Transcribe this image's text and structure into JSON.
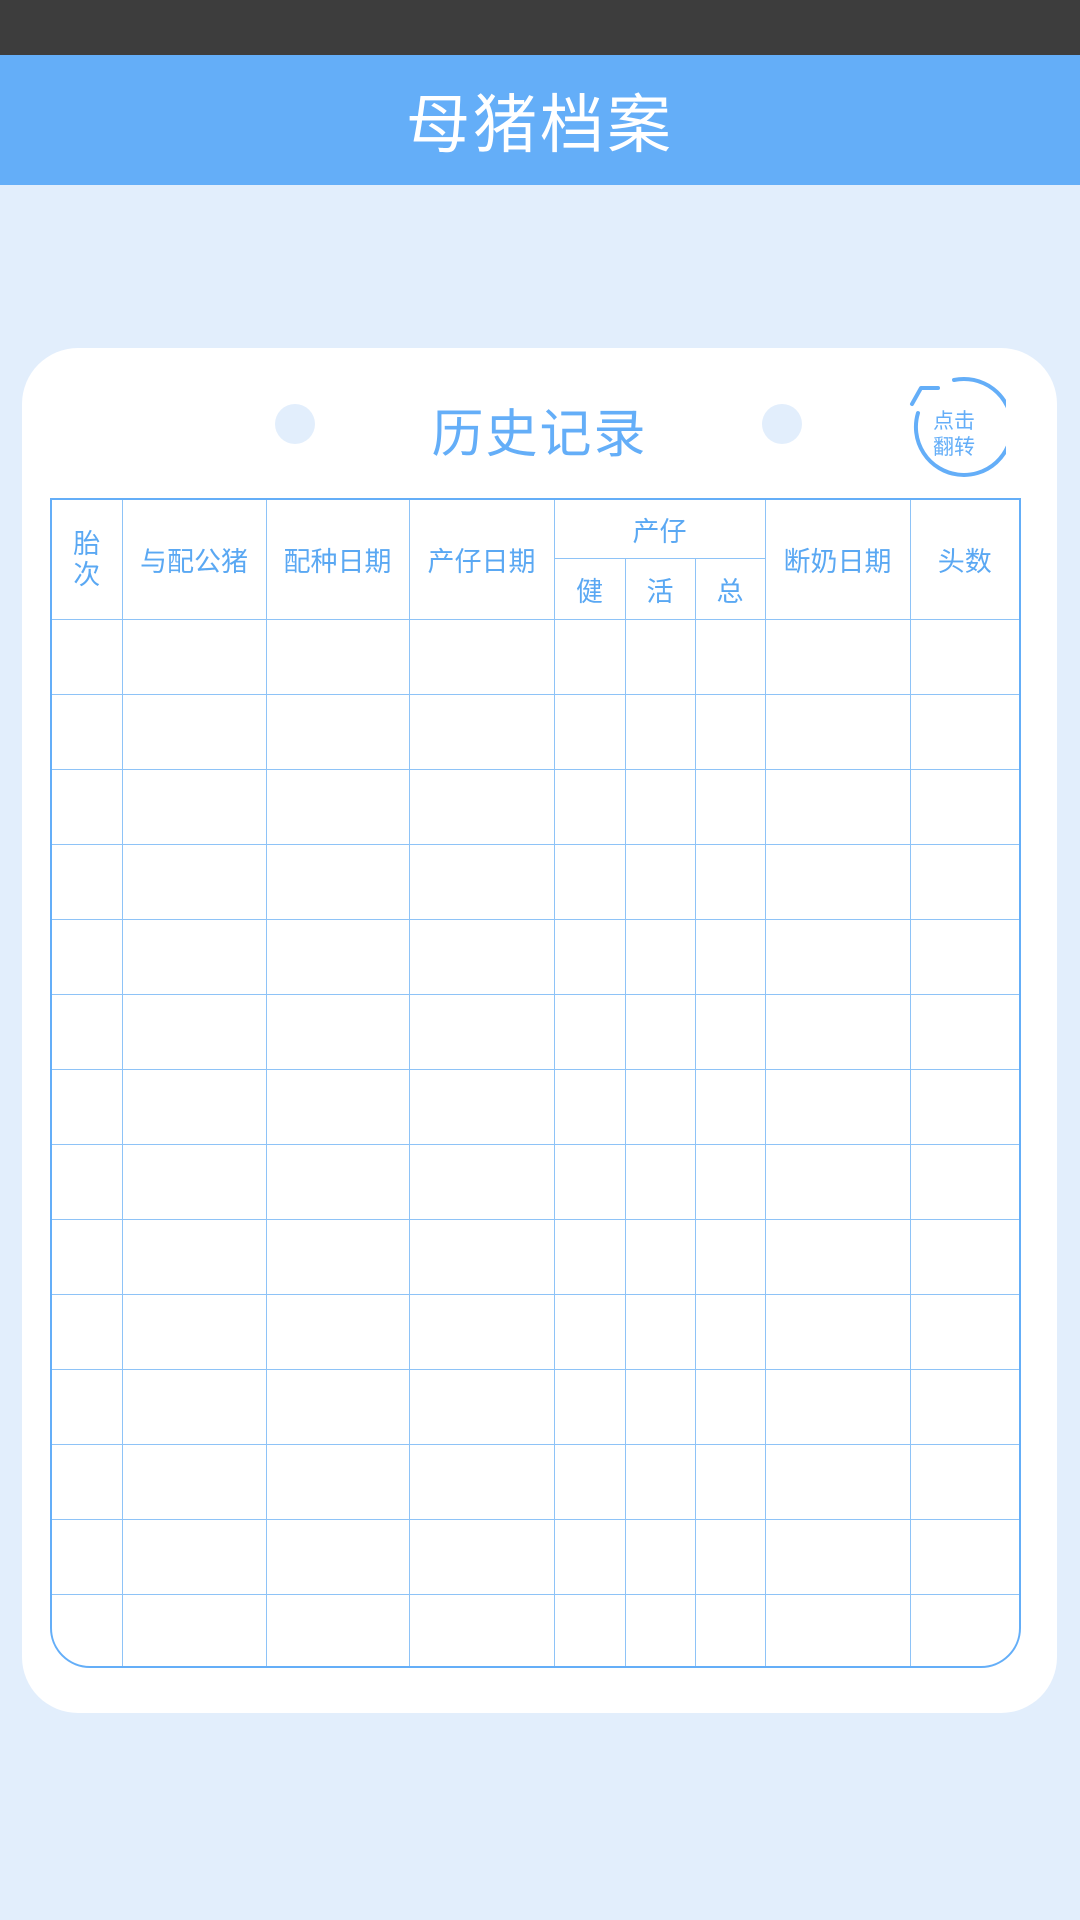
{
  "header": {
    "title": "母猪档案"
  },
  "card": {
    "title": "历史记录",
    "flip_button": {
      "line1": "点击",
      "line2": "翻转"
    }
  },
  "table": {
    "columns": {
      "parity_line1": "胎",
      "parity_line2": "次",
      "boar": "与配公猪",
      "breeding_date": "配种日期",
      "farrowing_date": "产仔日期",
      "litter_group": "产仔",
      "healthy": "健",
      "alive": "活",
      "total": "总",
      "weaning_date": "断奶日期",
      "head_count": "头数"
    },
    "rows": [
      [
        "",
        "",
        "",
        "",
        "",
        "",
        "",
        "",
        ""
      ],
      [
        "",
        "",
        "",
        "",
        "",
        "",
        "",
        "",
        ""
      ],
      [
        "",
        "",
        "",
        "",
        "",
        "",
        "",
        "",
        ""
      ],
      [
        "",
        "",
        "",
        "",
        "",
        "",
        "",
        "",
        ""
      ],
      [
        "",
        "",
        "",
        "",
        "",
        "",
        "",
        "",
        ""
      ],
      [
        "",
        "",
        "",
        "",
        "",
        "",
        "",
        "",
        ""
      ],
      [
        "",
        "",
        "",
        "",
        "",
        "",
        "",
        "",
        ""
      ],
      [
        "",
        "",
        "",
        "",
        "",
        "",
        "",
        "",
        ""
      ],
      [
        "",
        "",
        "",
        "",
        "",
        "",
        "",
        "",
        ""
      ],
      [
        "",
        "",
        "",
        "",
        "",
        "",
        "",
        "",
        ""
      ],
      [
        "",
        "",
        "",
        "",
        "",
        "",
        "",
        "",
        ""
      ],
      [
        "",
        "",
        "",
        "",
        "",
        "",
        "",
        "",
        ""
      ],
      [
        "",
        "",
        "",
        "",
        "",
        "",
        "",
        "",
        ""
      ],
      [
        "",
        "",
        "",
        "",
        "",
        "",
        "",
        "",
        ""
      ]
    ]
  },
  "colors": {
    "accent": "#64aef8",
    "background": "#e2eefc",
    "statusbar": "#3d3d3d",
    "card": "#ffffff"
  },
  "icons": {
    "flip": "rotate-arrow-icon"
  }
}
